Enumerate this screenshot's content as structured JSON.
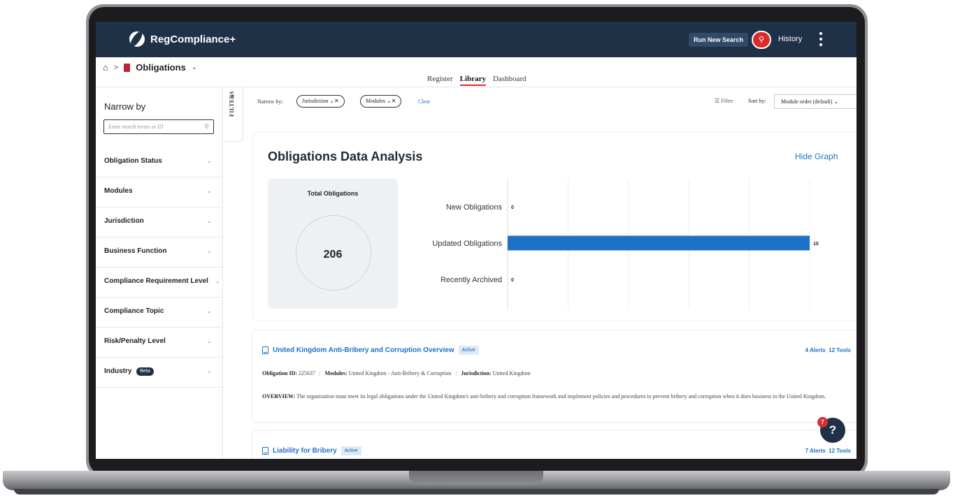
{
  "header": {
    "app_name": "RegCompliance+",
    "run_search_label": "Run New Search",
    "history_label": "History"
  },
  "breadcrumb": {
    "current_page": "Obligations"
  },
  "view_tabs": [
    {
      "label": "Register",
      "active": false
    },
    {
      "label": "Library",
      "active": true
    },
    {
      "label": "Dashboard",
      "active": false
    }
  ],
  "sidebar": {
    "title": "Narrow by",
    "search_placeholder": "Enter search terms or ID",
    "facets": [
      {
        "label": "Obligation Status"
      },
      {
        "label": "Modules"
      },
      {
        "label": "Jurisdiction"
      },
      {
        "label": "Business Function"
      },
      {
        "label": "Compliance Requirement Level"
      },
      {
        "label": "Compliance Topic"
      },
      {
        "label": "Risk/Penalty Level"
      },
      {
        "label": "Industry",
        "badge": "Beta"
      }
    ],
    "filters_tab_label": "FILTERS"
  },
  "filter_bar": {
    "narrow_label": "Narrow by:",
    "chips": [
      "Jurisdiction",
      "Modules"
    ],
    "clear_label": "Clear",
    "filter_label": "Filter",
    "sort_label": "Sort by:",
    "sort_value": "Module order (default)"
  },
  "analysis": {
    "title": "Obligations Data Analysis",
    "hide_graph_label": "Hide Graph",
    "total_label": "Total Obligations",
    "total_value": "206"
  },
  "chart_data": {
    "type": "bar",
    "orientation": "horizontal",
    "categories": [
      "New Obligations",
      "Updated Obligations",
      "Recently Archived"
    ],
    "values": [
      0,
      10,
      0
    ],
    "value_labels": [
      "0",
      "10",
      "0"
    ],
    "xlim": [
      0,
      10
    ],
    "grid": true,
    "bar_color": "#1d72c8"
  },
  "results": [
    {
      "title": "United Kingdom Anti-Bribery and Corruption Overview",
      "status": "Active",
      "alerts": "4 Alerts",
      "tools": "12 Tools",
      "obligation_id_label": "Obligation ID:",
      "obligation_id": "225637",
      "modules_label": "Modules:",
      "modules": "United Kingdom - Anti-Bribery & Corruption",
      "jurisdiction_label": "Jurisdiction:",
      "jurisdiction": "United Kingdom",
      "overview_label": "OVERVIEW:",
      "overview": "The organisation must meet its legal obligations under the United Kingdom's anti-bribery and corruption framework and implement policies and procedures to prevent bribery and corruption when it does business in the United Kingdom."
    },
    {
      "title": "Liability for Bribery",
      "status": "Active",
      "alerts": "7 Alerts",
      "tools": "12 Tools"
    }
  ],
  "help": {
    "label": "?",
    "badge_count": "7"
  },
  "colors": {
    "header_bg": "#1f3146",
    "accent_red": "#d92d2d",
    "link_blue": "#1d72c8",
    "bar_blue": "#1d72c8"
  }
}
